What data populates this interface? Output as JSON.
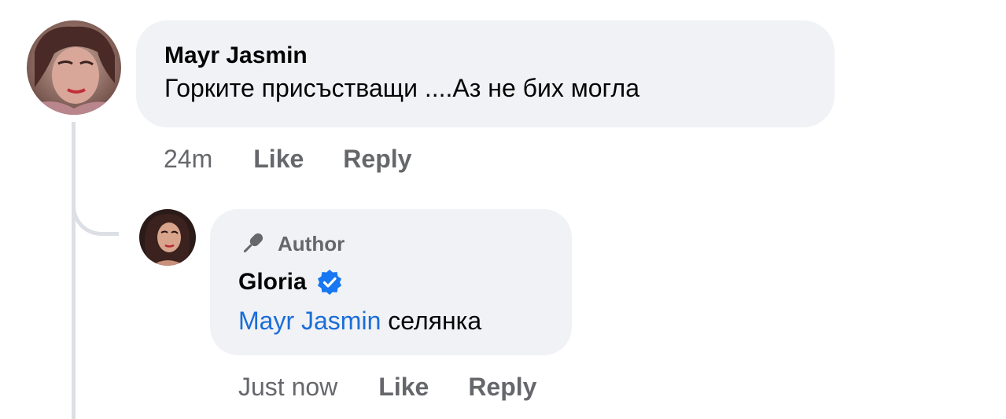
{
  "comment": {
    "author": "Mayr Jasmin",
    "text": "Горките  присъстващи ....Аз не бих могла",
    "time": "24m",
    "like_label": "Like",
    "reply_label": "Reply"
  },
  "reply": {
    "badge_label": "Author",
    "author": "Gloria",
    "verified_icon": "verified-badge-icon",
    "mention": "Mayr Jasmin",
    "text": " селянка",
    "time": "Just now",
    "like_label": "Like",
    "reply_label": "Reply"
  },
  "colors": {
    "bubble_bg": "#f0f2f5",
    "secondary_text": "#65676b",
    "mention_blue": "#1a6dd8",
    "verified_blue": "#1877f2",
    "thread_line": "#dcdfe4"
  }
}
